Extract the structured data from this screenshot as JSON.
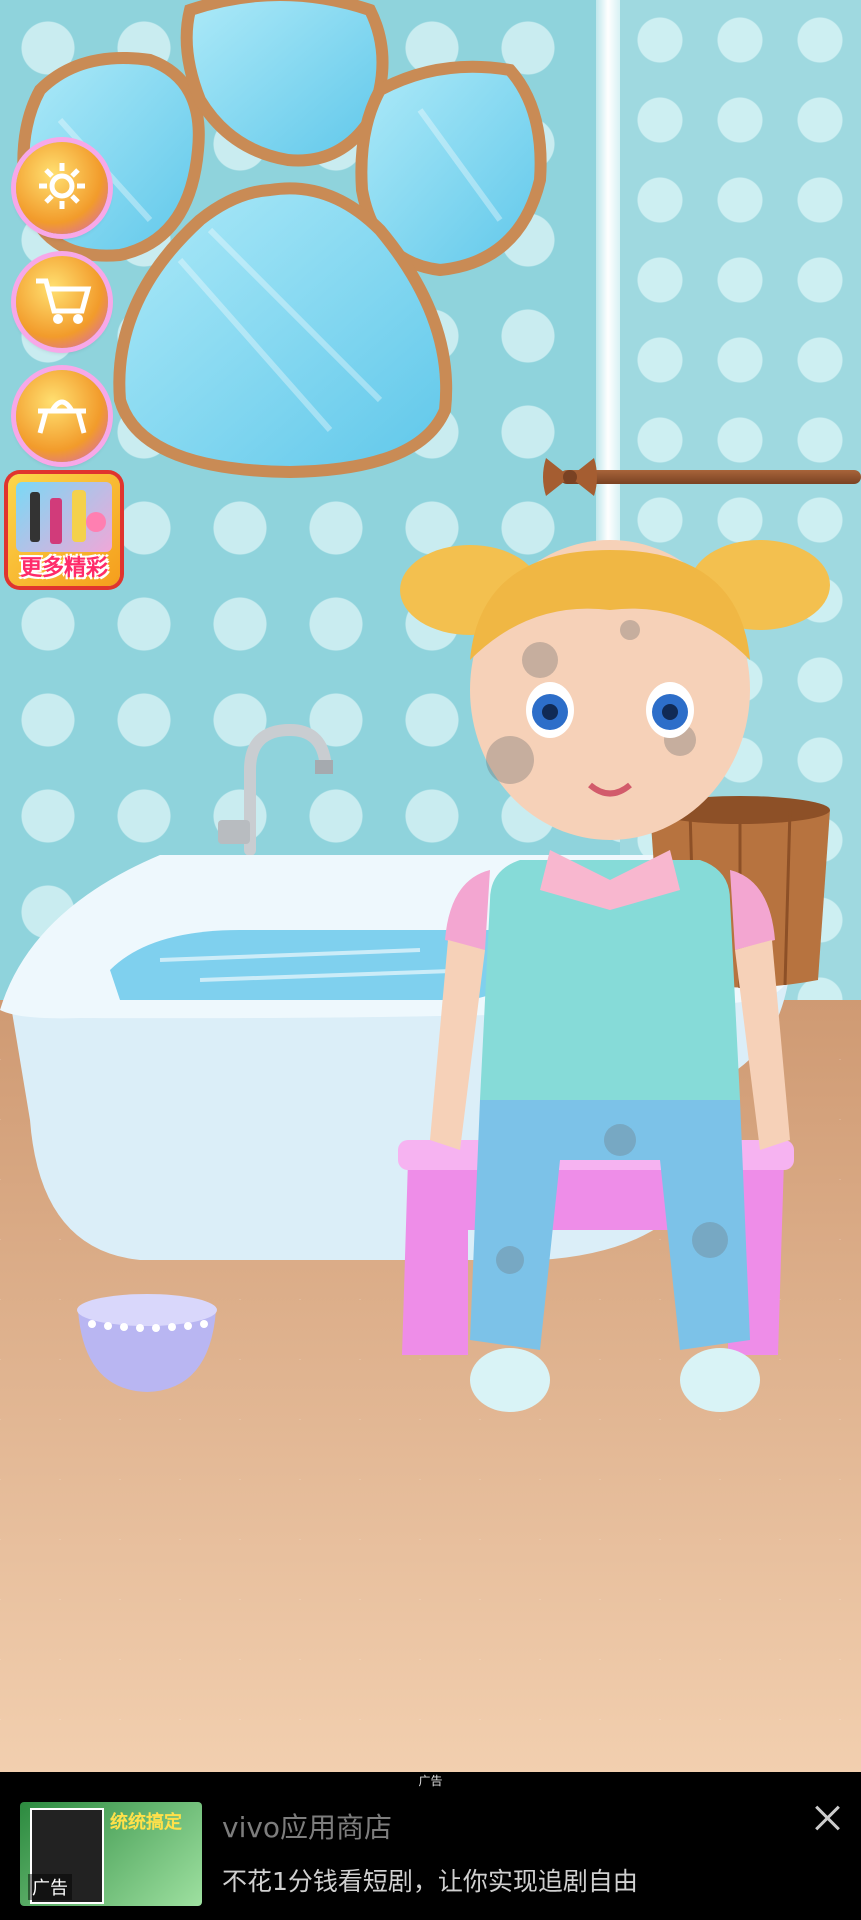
{
  "game": {
    "scene": "bathroom",
    "side_buttons": [
      {
        "name": "settings",
        "icon": "gear-icon"
      },
      {
        "name": "shop",
        "icon": "cart-icon"
      },
      {
        "name": "changing-table",
        "icon": "table-icon"
      }
    ],
    "more_games_label": "更多精彩"
  },
  "ad": {
    "tag": "广告",
    "title": "vivo应用商店",
    "description": "不花1分钱看短剧，让你实现追剧自由",
    "thumb_slogan": "统统搞定",
    "thumb_badge": "广告",
    "close_icon": "close-icon"
  },
  "colors": {
    "wall": "#8fd3dc",
    "floor": "#e0b18c",
    "accent_pink": "#f7a8e8",
    "ad_background": "#000000"
  }
}
